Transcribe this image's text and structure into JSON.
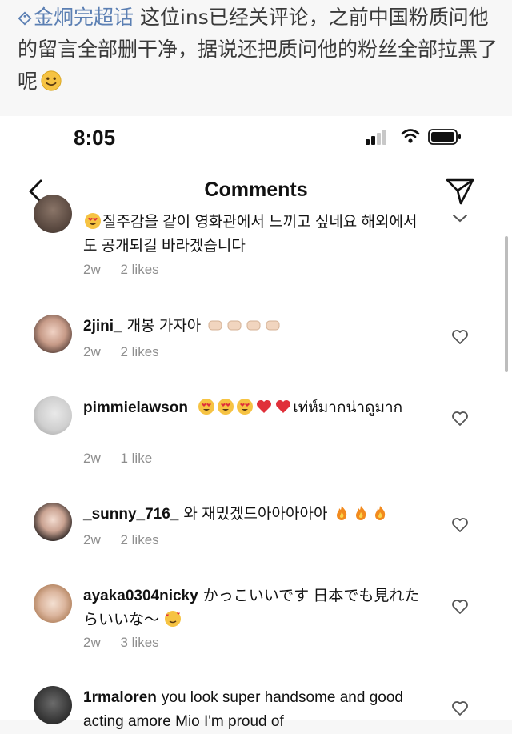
{
  "caption": {
    "mention": "金炯完超话",
    "text": " 这位ins已经关评论，之前中国粉质问他的留言全部删干净，据说还把质问他的粉丝全部拉黑了呢"
  },
  "status_bar": {
    "time": "8:05"
  },
  "nav": {
    "title": "Comments"
  },
  "comments": [
    {
      "username": "",
      "text": "질주감을 같이 영화관에서 느끼고 싶네요 해외에서도 공개되길 바라겠습니다",
      "time": "2w",
      "likes": "2 likes"
    },
    {
      "username": "2jini_",
      "text": "개봉 가자아",
      "time": "2w",
      "likes": "2 likes"
    },
    {
      "username": "pimmielawson",
      "text": "เท่ห์มากน่าดูมาก",
      "time": "2w",
      "likes": "1 like"
    },
    {
      "username": "_sunny_716_",
      "text": "와 재밌겠드아아아아아",
      "time": "2w",
      "likes": "2 likes"
    },
    {
      "username": "ayaka0304nicky",
      "text": "かっこいいです 日本でも見れたらいいな〜",
      "time": "2w",
      "likes": "3 likes"
    },
    {
      "username": "1rmaloren",
      "text": "you look super handsome and good acting amore Mio I'm proud of",
      "time": "",
      "likes": ""
    }
  ],
  "colors": {
    "mention": "#5b7fb3",
    "meta_gray": "#8e8e8e",
    "heart_red": "#e0303a",
    "emoji_yellow": "#f6c343"
  },
  "icons": [
    "tag-icon",
    "smile-emoji",
    "signal-icon",
    "wifi-icon",
    "battery-icon",
    "back-icon",
    "send-icon",
    "heart-icon"
  ]
}
